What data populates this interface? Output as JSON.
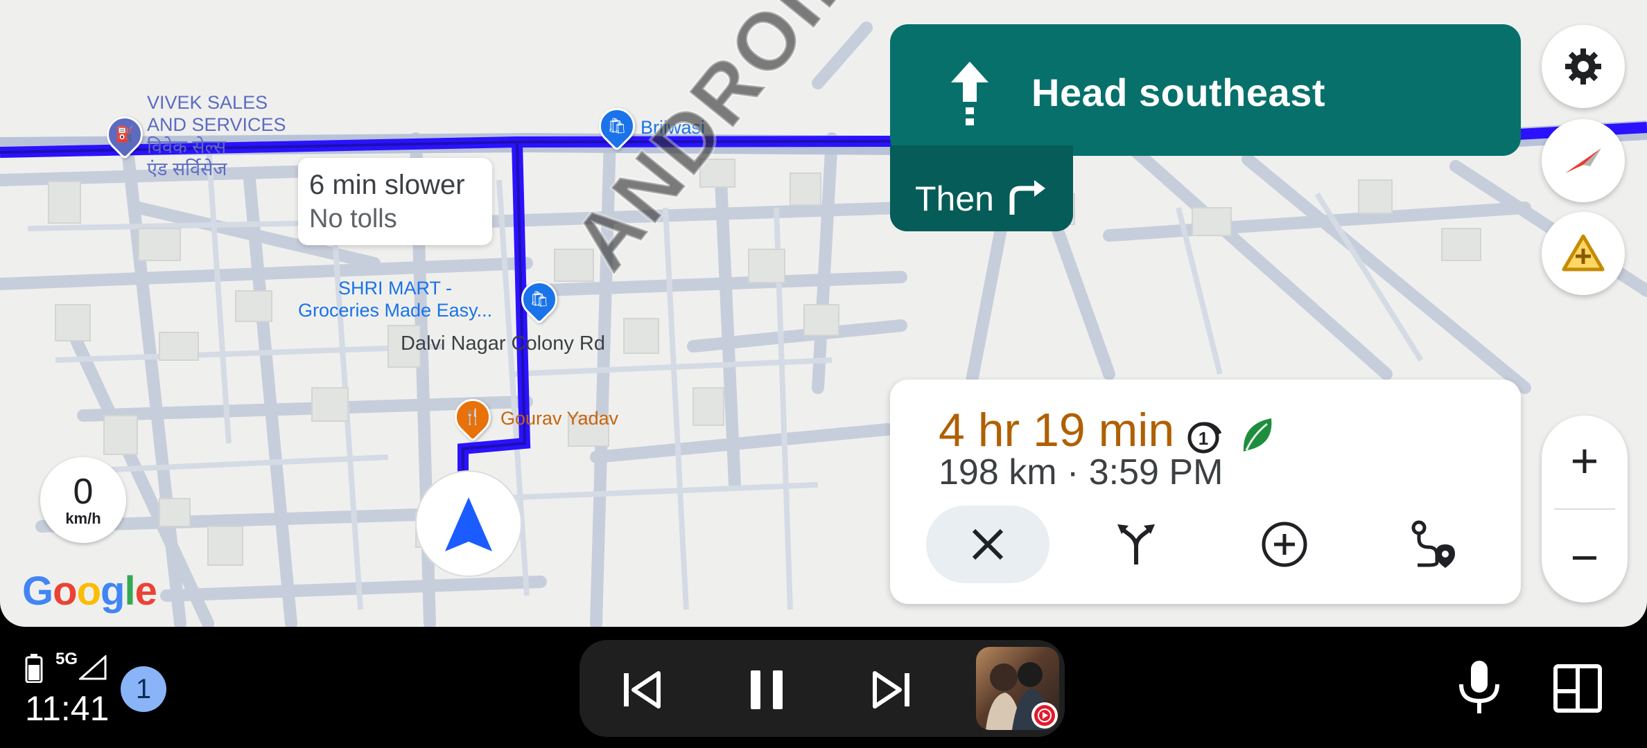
{
  "map": {
    "pois": [
      {
        "name": "VIVEK SALES\nAND SERVICES\nविवेक सेल्स\nएंड सर्विसेज",
        "type": "fuel",
        "color": "#5c6bc0"
      },
      {
        "name": "Brijwasi",
        "type": "shop",
        "color": "#1a73e8"
      },
      {
        "name": "SHRI MART -\nGroceries Made Easy...",
        "type": "shop",
        "color": "#1a73e8"
      },
      {
        "name": "Gourav Yadav",
        "type": "restaurant",
        "color": "#e8710a"
      }
    ],
    "road_label": "Dalvi Nagar Colony Rd",
    "route_color": "#2b12ff"
  },
  "alt_route": {
    "line1": "6 min slower",
    "line2": "No tolls"
  },
  "nav": {
    "instruction": "Head southeast",
    "then_label": "Then",
    "banner_color": "#08706b",
    "icon": "arrow-straight-icon",
    "then_icon": "turn-right-icon"
  },
  "side_buttons": [
    "settings-icon",
    "compass-icon",
    "report-incident-icon"
  ],
  "zoom": {
    "plus": "+",
    "minus": "−"
  },
  "trip": {
    "eta": "4 hr 19 min",
    "summary": "198 km · 3:59 PM",
    "actions": [
      "close-icon",
      "alternate-routes-icon",
      "add-stop-icon",
      "route-overview-icon"
    ]
  },
  "speed": {
    "value": "0",
    "unit": "km/h"
  },
  "brand": {
    "logo": "Google"
  },
  "watermark": "ANDROID AUTHORITY",
  "statusbar": {
    "network": "5G",
    "time": "11:41",
    "notification_count": "1"
  },
  "media": {
    "controls": [
      "skip-previous-icon",
      "pause-icon",
      "skip-next-icon"
    ]
  }
}
